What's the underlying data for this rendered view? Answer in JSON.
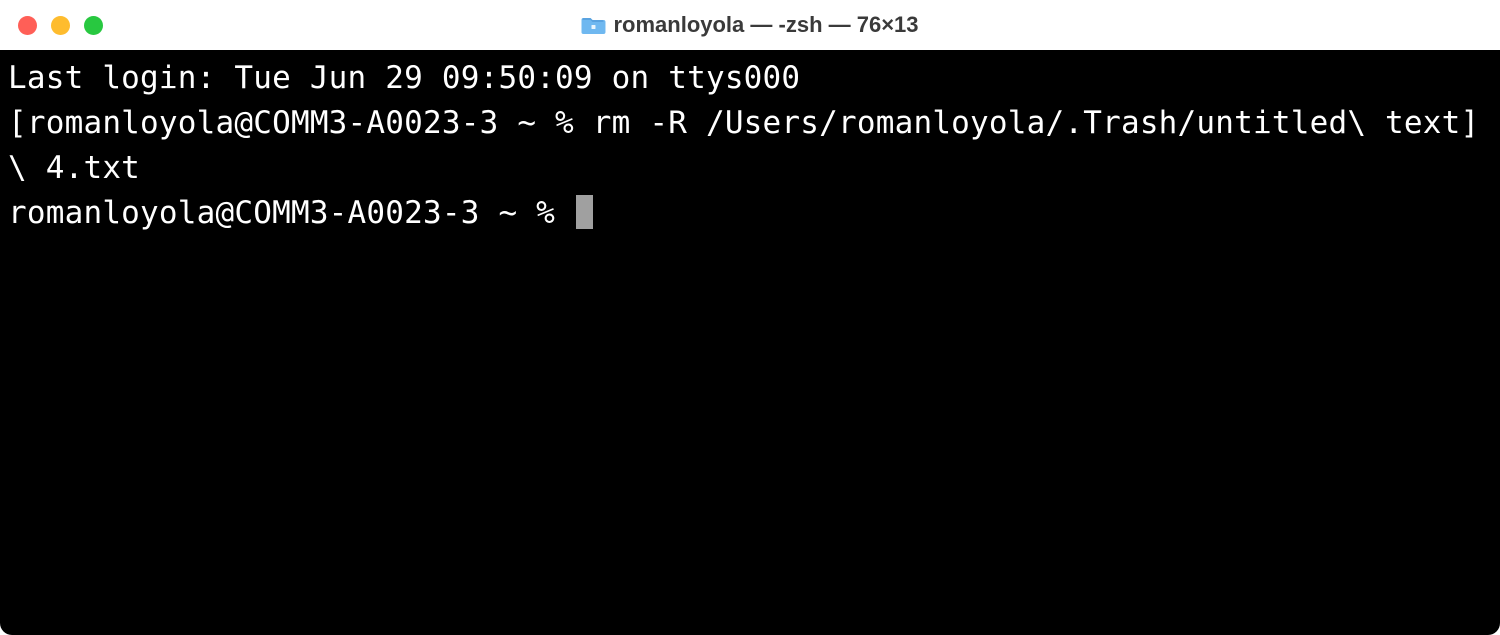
{
  "titlebar": {
    "title": "romanloyola — -zsh — 76×13"
  },
  "terminal": {
    "lines": [
      "Last login: Tue Jun 29 09:50:09 on ttys000",
      "[romanloyola@COMM3-A0023-3 ~ % rm -R /Users/romanloyola/.Trash/untitled\\ text]",
      "\\ 4.txt",
      "romanloyola@COMM3-A0023-3 ~ % "
    ]
  }
}
